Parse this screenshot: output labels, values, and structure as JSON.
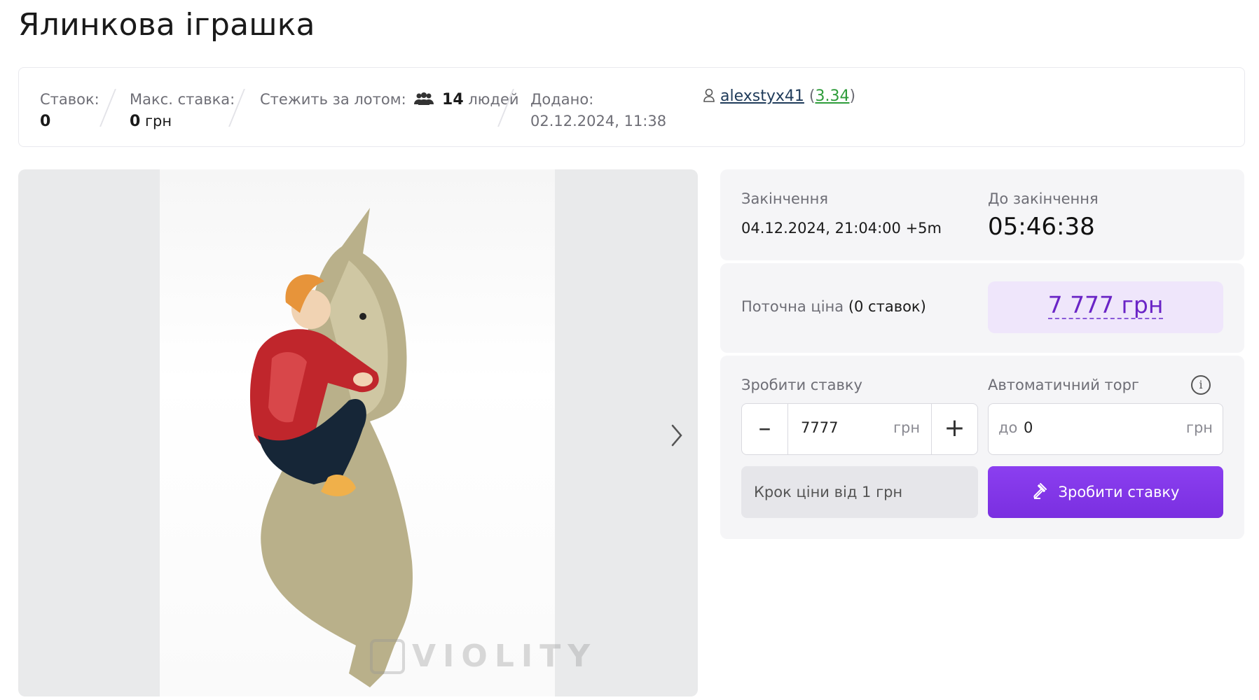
{
  "page": {
    "title": "Ялинкова іграшка"
  },
  "info_bar": {
    "bids_label": "Ставок:",
    "bids_value": "0",
    "max_bid_label": "Макс. ставка:",
    "max_bid_value": "0",
    "max_bid_currency": "грн",
    "watchers_label": "Стежить за лотом:",
    "watchers_count": "14",
    "watchers_unit": "людей",
    "added_label": "Додано:",
    "added_value": "02.12.2024, 11:38",
    "seller_name": "alexstyx41",
    "seller_rating": "3.34"
  },
  "gallery": {
    "watermark": "VIOLITY"
  },
  "auction": {
    "end_label": "Закінчення",
    "end_value": "04.12.2024, 21:04:00 +5m",
    "remaining_label": "До закінчення",
    "remaining_value": "05:46:38",
    "current_price_label": "Поточна ціна",
    "current_price_bids": "(0 ставок)",
    "current_price": "7 777 грн",
    "bid_label": "Зробити ставку",
    "bid_value": "7777",
    "bid_unit": "грн",
    "auto_label": "Автоматичний торг",
    "auto_prefix": "до",
    "auto_value": "0",
    "auto_unit": "грн",
    "step_note": "Крок ціни від 1 грн",
    "bid_button": "Зробити ставку"
  },
  "colors": {
    "accent": "#7a2fe0",
    "price": "#6a24c6",
    "rating": "#2e9c3a"
  },
  "icons": [
    "people-icon",
    "user-icon",
    "chevron-right-icon",
    "info-icon",
    "minus-icon",
    "plus-icon",
    "gavel-icon"
  ]
}
